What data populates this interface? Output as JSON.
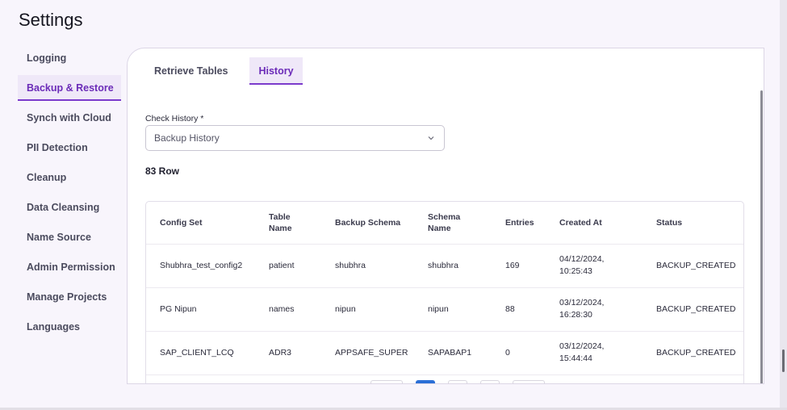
{
  "page": {
    "title": "Settings"
  },
  "sidebar": {
    "items": [
      {
        "label": "Logging"
      },
      {
        "label": "Backup & Restore",
        "active": true
      },
      {
        "label": "Synch with Cloud"
      },
      {
        "label": "PII Detection"
      },
      {
        "label": "Cleanup"
      },
      {
        "label": "Data Cleansing"
      },
      {
        "label": "Name Source"
      },
      {
        "label": "Admin Permission"
      },
      {
        "label": "Manage Projects"
      },
      {
        "label": "Languages"
      }
    ]
  },
  "tabs": [
    {
      "label": "Retrieve Tables"
    },
    {
      "label": "History",
      "active": true
    }
  ],
  "check_history": {
    "label": "Check History *",
    "value": "Backup History",
    "icon": "chevron-down-icon"
  },
  "row_count": "83 Row",
  "table": {
    "columns": [
      {
        "line1": "Config Set",
        "line2": ""
      },
      {
        "line1": "Table",
        "line2": "Name"
      },
      {
        "line1": "Backup Schema",
        "line2": ""
      },
      {
        "line1": "Schema",
        "line2": "Name"
      },
      {
        "line1": "Entries",
        "line2": ""
      },
      {
        "line1": "Created At",
        "line2": ""
      },
      {
        "line1": "Status",
        "line2": ""
      }
    ],
    "rows": [
      {
        "config_set": "Shubhra_test_config2",
        "table_name": "patient",
        "backup_schema": "shubhra",
        "schema_name": "shubhra",
        "entries": "169",
        "created_date": "04/12/2024,",
        "created_time": "10:25:43",
        "status": "BACKUP_CREATED"
      },
      {
        "config_set": "PG Nipun",
        "table_name": "names",
        "backup_schema": "nipun",
        "schema_name": "nipun",
        "entries": "88",
        "created_date": "03/12/2024,",
        "created_time": "16:28:30",
        "status": "BACKUP_CREATED"
      },
      {
        "config_set": "SAP_CLIENT_LCQ",
        "table_name": "ADR3",
        "backup_schema": "APPSAFE_SUPER",
        "schema_name": "SAPABAP1",
        "entries": "0",
        "created_date": "03/12/2024,",
        "created_time": "15:44:44",
        "status": "BACKUP_CREATED"
      }
    ]
  },
  "colors": {
    "accent": "#6b2bb8",
    "accent_bg": "#efe8f8",
    "pager_active": "#2b6fd6"
  }
}
